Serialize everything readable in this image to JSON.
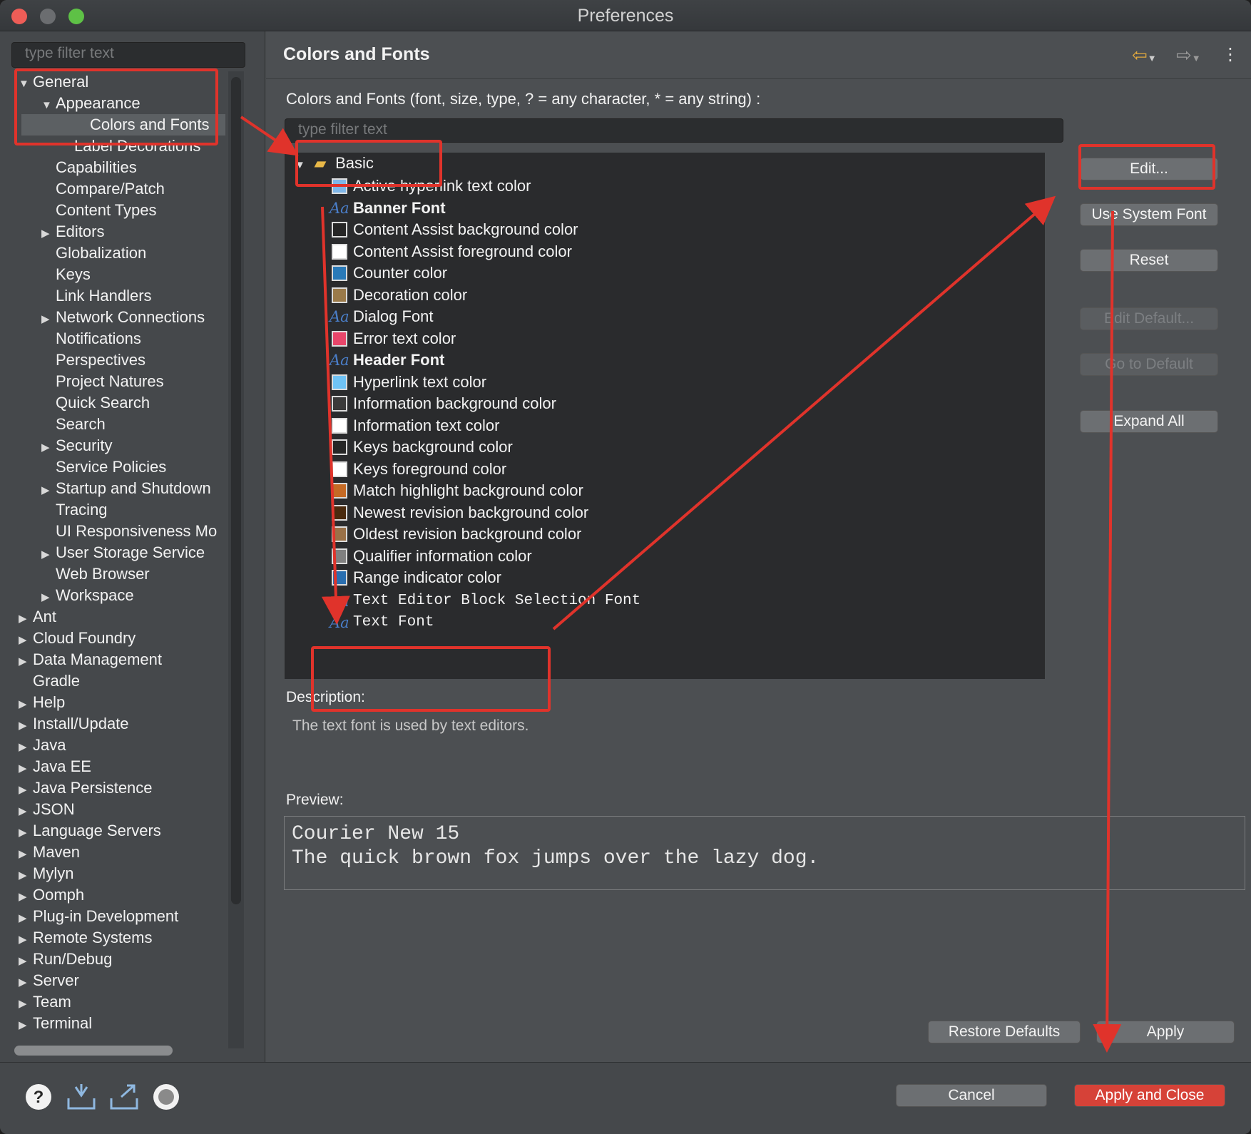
{
  "window": {
    "title": "Preferences"
  },
  "left": {
    "filter_placeholder": "type filter text",
    "tree": [
      {
        "label": "General",
        "twisty": "▼",
        "level": 0
      },
      {
        "label": "Appearance",
        "twisty": "▼",
        "level": 1
      },
      {
        "label": "Colors and Fonts",
        "twisty": "",
        "level": 2,
        "selected": true
      },
      {
        "label": "Label Decorations",
        "twisty": "",
        "level": 2
      },
      {
        "label": "Capabilities",
        "twisty": "",
        "level": 1
      },
      {
        "label": "Compare/Patch",
        "twisty": "",
        "level": 1
      },
      {
        "label": "Content Types",
        "twisty": "",
        "level": 1
      },
      {
        "label": "Editors",
        "twisty": "▶",
        "level": 1
      },
      {
        "label": "Globalization",
        "twisty": "",
        "level": 1
      },
      {
        "label": "Keys",
        "twisty": "",
        "level": 1
      },
      {
        "label": "Link Handlers",
        "twisty": "",
        "level": 1
      },
      {
        "label": "Network Connections",
        "twisty": "▶",
        "level": 1
      },
      {
        "label": "Notifications",
        "twisty": "",
        "level": 1
      },
      {
        "label": "Perspectives",
        "twisty": "",
        "level": 1
      },
      {
        "label": "Project Natures",
        "twisty": "",
        "level": 1
      },
      {
        "label": "Quick Search",
        "twisty": "",
        "level": 1
      },
      {
        "label": "Search",
        "twisty": "",
        "level": 1
      },
      {
        "label": "Security",
        "twisty": "▶",
        "level": 1
      },
      {
        "label": "Service Policies",
        "twisty": "",
        "level": 1
      },
      {
        "label": "Startup and Shutdown",
        "twisty": "▶",
        "level": 1
      },
      {
        "label": "Tracing",
        "twisty": "",
        "level": 1
      },
      {
        "label": "UI Responsiveness Mo",
        "twisty": "",
        "level": 1
      },
      {
        "label": "User Storage Service",
        "twisty": "▶",
        "level": 1
      },
      {
        "label": "Web Browser",
        "twisty": "",
        "level": 1
      },
      {
        "label": "Workspace",
        "twisty": "▶",
        "level": 1
      },
      {
        "label": "Ant",
        "twisty": "▶",
        "level": 0
      },
      {
        "label": "Cloud Foundry",
        "twisty": "▶",
        "level": 0
      },
      {
        "label": "Data Management",
        "twisty": "▶",
        "level": 0
      },
      {
        "label": "Gradle",
        "twisty": "",
        "level": 0
      },
      {
        "label": "Help",
        "twisty": "▶",
        "level": 0
      },
      {
        "label": "Install/Update",
        "twisty": "▶",
        "level": 0
      },
      {
        "label": "Java",
        "twisty": "▶",
        "level": 0
      },
      {
        "label": "Java EE",
        "twisty": "▶",
        "level": 0
      },
      {
        "label": "Java Persistence",
        "twisty": "▶",
        "level": 0
      },
      {
        "label": "JSON",
        "twisty": "▶",
        "level": 0
      },
      {
        "label": "Language Servers",
        "twisty": "▶",
        "level": 0
      },
      {
        "label": "Maven",
        "twisty": "▶",
        "level": 0
      },
      {
        "label": "Mylyn",
        "twisty": "▶",
        "level": 0
      },
      {
        "label": "Oomph",
        "twisty": "▶",
        "level": 0
      },
      {
        "label": "Plug-in Development",
        "twisty": "▶",
        "level": 0
      },
      {
        "label": "Remote Systems",
        "twisty": "▶",
        "level": 0
      },
      {
        "label": "Run/Debug",
        "twisty": "▶",
        "level": 0
      },
      {
        "label": "Server",
        "twisty": "▶",
        "level": 0
      },
      {
        "label": "Team",
        "twisty": "▶",
        "level": 0
      },
      {
        "label": "Terminal",
        "twisty": "▶",
        "level": 0
      }
    ]
  },
  "main": {
    "title": "Colors and Fonts",
    "hint": "Colors and Fonts (font, size, type, ? = any character, * = any string) :",
    "filter_placeholder": "type filter text",
    "category": "Basic",
    "items": [
      {
        "label": "Active hyperlink text color",
        "kind": "color",
        "color": "#7fb6e8"
      },
      {
        "label": "Banner Font",
        "kind": "font",
        "bold": true
      },
      {
        "label": "Content Assist background color",
        "kind": "color",
        "color": "#262626"
      },
      {
        "label": "Content Assist foreground color",
        "kind": "color",
        "color": "#ffffff"
      },
      {
        "label": "Counter color",
        "kind": "color",
        "color": "#2a7ab8"
      },
      {
        "label": "Decoration color",
        "kind": "color",
        "color": "#9a7a4a"
      },
      {
        "label": "Dialog Font",
        "kind": "font"
      },
      {
        "label": "Error text color",
        "kind": "color",
        "color": "#e8466a"
      },
      {
        "label": "Header Font",
        "kind": "font",
        "bold": true
      },
      {
        "label": "Hyperlink text color",
        "kind": "color",
        "color": "#6fc3f5"
      },
      {
        "label": "Information background color",
        "kind": "color",
        "color": "#3a3a3a"
      },
      {
        "label": "Information text color",
        "kind": "color",
        "color": "#ffffff"
      },
      {
        "label": "Keys background color",
        "kind": "color",
        "color": "#262626"
      },
      {
        "label": "Keys foreground color",
        "kind": "color",
        "color": "#ffffff"
      },
      {
        "label": "Match highlight background color",
        "kind": "color",
        "color": "#c56a25"
      },
      {
        "label": "Newest revision background color",
        "kind": "color",
        "color": "#4a2a0e"
      },
      {
        "label": "Oldest revision background color",
        "kind": "color",
        "color": "#9a7148"
      },
      {
        "label": "Qualifier information color",
        "kind": "color",
        "color": "#808080"
      },
      {
        "label": "Range indicator color",
        "kind": "color",
        "color": "#2a6fb0"
      },
      {
        "label": "Text Editor Block Selection Font",
        "kind": "font",
        "mono": true
      },
      {
        "label": "Text Font",
        "kind": "font",
        "mono": true,
        "selected": true
      }
    ],
    "buttons": {
      "edit": "Edit...",
      "use_system_font": "Use System Font",
      "reset": "Reset",
      "edit_default": "Edit Default...",
      "go_to_default": "Go to Default",
      "expand_all": "Expand All"
    },
    "description_label": "Description:",
    "description_text": "The text font is used by text editors.",
    "preview_label": "Preview:",
    "preview_line1": "Courier New 15",
    "preview_line2": "The quick brown fox jumps over the lazy dog.",
    "restore_defaults": "Restore Defaults",
    "apply": "Apply"
  },
  "footer": {
    "cancel": "Cancel",
    "apply_and_close": "Apply and Close",
    "icons": [
      "help-icon",
      "import-icon",
      "export-icon",
      "oomph-record-icon"
    ]
  },
  "colors": {
    "annotation": "#e0332b",
    "selection": "#d0393b",
    "primary_button": "#d64238"
  }
}
